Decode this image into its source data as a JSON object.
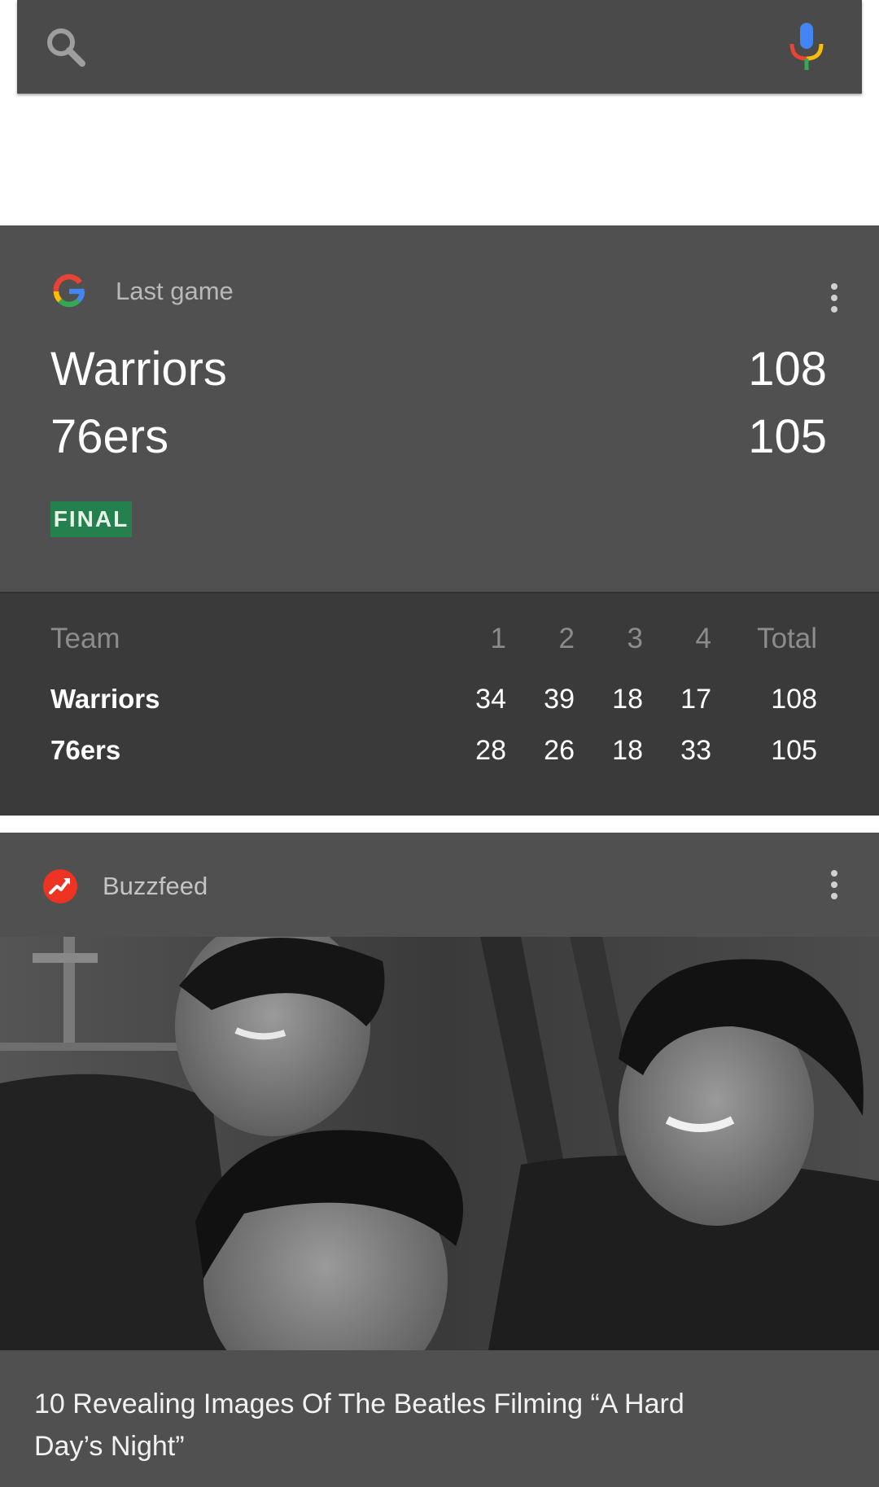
{
  "search": {
    "placeholder": "",
    "left_icon": "search-icon",
    "right_icon": "mic-icon",
    "mic_colors": [
      "#4285f4",
      "#ea4335",
      "#fbbc05",
      "#34a853"
    ]
  },
  "score_card": {
    "source_icon": "google-g-logo-icon",
    "source_label": "Last game",
    "menu_icon": "more-vert-icon",
    "teams": [
      {
        "name": "Warriors",
        "score": "108"
      },
      {
        "name": "76ers",
        "score": "105"
      }
    ],
    "status": "FINAL",
    "status_color": "#24804d",
    "box_score": {
      "headers": [
        "Team",
        "1",
        "2",
        "3",
        "4",
        "Total"
      ],
      "rows": [
        {
          "team": "Warriors",
          "q1": "34",
          "q2": "39",
          "q3": "18",
          "q4": "17",
          "total": "108"
        },
        {
          "team": "76ers",
          "q1": "28",
          "q2": "26",
          "q3": "18",
          "q4": "33",
          "total": "105"
        }
      ]
    }
  },
  "news_card": {
    "source_icon": "buzzfeed-trending-icon",
    "source_label": "Buzzfeed",
    "brand_color": "#ee3322",
    "menu_icon": "more-vert-icon",
    "image": "black-and-white-photo-of-three-smiling-men",
    "title": "10 Revealing Images Of The Beatles Filming “A Hard Day’s Night”"
  }
}
